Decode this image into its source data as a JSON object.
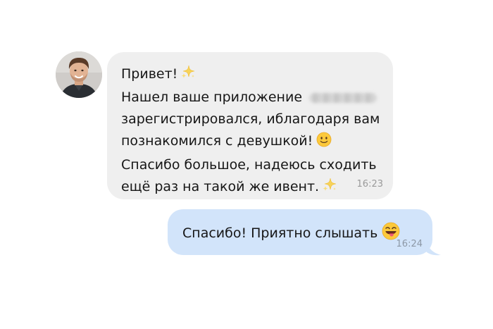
{
  "incoming": {
    "lines": [
      "Привет!",
      "Нашел ваше приложение",
      "зарегистрировался, иблагодаря вам",
      "познакомился с девушкой!",
      "Спасибо большое, надеюсь сходить",
      "ещё раз на такой же ивент."
    ],
    "time": "16:23",
    "icons": [
      "sparkles-icon",
      "slightly-smiling-face-icon",
      "sparkles-icon"
    ]
  },
  "outgoing": {
    "text": "Спасибо! Приятно слышать",
    "time": "16:24",
    "icons": [
      "face-with-tongue-icon"
    ]
  },
  "colors": {
    "incoming_bubble": "#efefef",
    "outgoing_bubble": "#d2e4fa",
    "text": "#161616",
    "timestamp": "#9a9a9a"
  }
}
